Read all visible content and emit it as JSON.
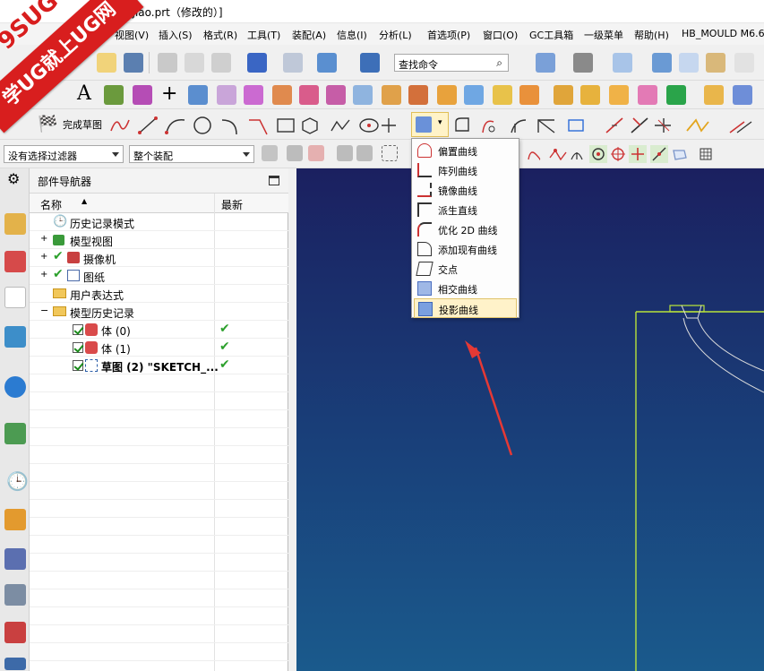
{
  "title": {
    "text": "ujiao.prt（修改的）]"
  },
  "watermark": {
    "line1": "9SUG",
    "line2": "学UG就上UG网"
  },
  "menu": [
    "视图(V)",
    "插入(S)",
    "格式(R)",
    "工具(T)",
    "装配(A)",
    "信息(I)",
    "分析(L)",
    "首选项(P)",
    "窗口(O)",
    "GC工具箱",
    "一级菜单",
    "帮助(H)",
    "HB_MOULD M6.6"
  ],
  "toolbar": {
    "search_placeholder": "查找命令",
    "finish_sketch": "完成草图",
    "filter_value": "没有选择过滤器",
    "assembly_value": "整个装配"
  },
  "navigator": {
    "title": "部件导航器",
    "col_name": "名称",
    "col_latest": "最新",
    "rows": [
      {
        "label": "历史记录模式"
      },
      {
        "label": "模型视图"
      },
      {
        "label": "摄像机"
      },
      {
        "label": "图纸"
      },
      {
        "label": "用户表达式"
      },
      {
        "label": "模型历史记录"
      },
      {
        "label": "体 (0)"
      },
      {
        "label": "体 (1)"
      },
      {
        "label": "草图 (2) \"SKETCH_..."
      }
    ]
  },
  "dropdown": {
    "items": [
      "偏置曲线",
      "阵列曲线",
      "镜像曲线",
      "派生直线",
      "优化 2D 曲线",
      "添加现有曲线",
      "交点",
      "相交曲线",
      "投影曲线"
    ],
    "selected_index": 8
  },
  "colors": {
    "accent_red": "#e53935",
    "gfx_top": "#1b2060",
    "gfx_bottom": "#1a5a8c",
    "sketch_line": "#b8e23a"
  }
}
